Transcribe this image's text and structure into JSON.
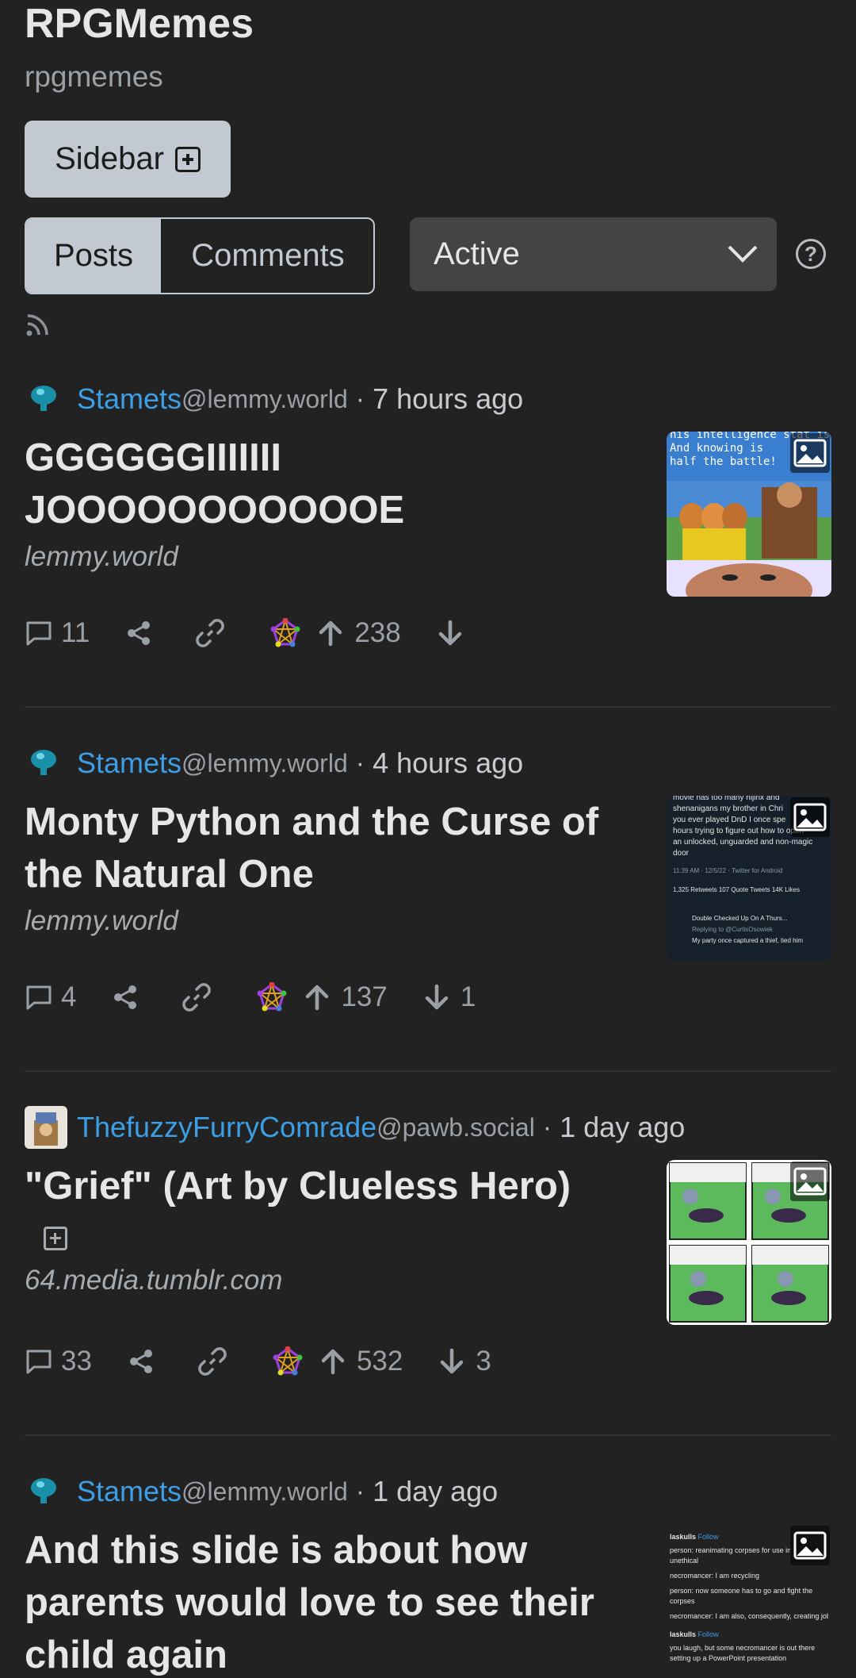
{
  "community": {
    "title": "RPGMemes",
    "name": "rpgmemes"
  },
  "buttons": {
    "sidebar_label": "Sidebar"
  },
  "view_toggle": {
    "posts_label": "Posts",
    "comments_label": "Comments"
  },
  "sort": {
    "selected": "Active"
  },
  "icons": {
    "help": "question-circle-icon",
    "rss": "rss-icon",
    "comment": "comment-icon",
    "share": "share-icon",
    "link": "link-icon",
    "fediverse": "fediverse-icon",
    "upvote": "arrow-up-icon",
    "downvote": "arrow-down-icon",
    "image": "image-icon",
    "expand": "plus-square-icon"
  },
  "colors": {
    "background": "#222222",
    "accent": "#3c9ee5",
    "button": "#c2c9d0",
    "select": "#444444"
  },
  "posts": [
    {
      "user": "Stamets",
      "instance": "@lemmy.world",
      "time": "7 hours ago",
      "title_line1": "GGGGGGIIIIIII",
      "title_line2": "JOOOOOOOOOOOE",
      "domain": "lemmy.world",
      "comments": "11",
      "upvotes": "238",
      "downvotes": ""
    },
    {
      "user": "Stamets",
      "instance": "@lemmy.world",
      "time": "4 hours ago",
      "title_line1": "Monty Python and the Curse of",
      "title_line2": "the Natural One",
      "domain": "lemmy.world",
      "comments": "4",
      "upvotes": "137",
      "downvotes": "1"
    },
    {
      "user": "ThefuzzyFurryComrade",
      "instance": "@pawb.social",
      "time": "1 day ago",
      "title_line1": "\"Grief\" (Art by Clueless Hero)",
      "title_line2": "",
      "domain": "64.media.tumblr.com",
      "comments": "33",
      "upvotes": "532",
      "downvotes": "3"
    },
    {
      "user": "Stamets",
      "instance": "@lemmy.world",
      "time": "1 day ago",
      "title_line1": "And this slide is about how",
      "title_line2": "parents would love to see their",
      "title_line3": "child again"
    }
  ],
  "thumb_text": {
    "p1": [
      "his intelligence stat is s",
      "And knowing is",
      "half the battle!"
    ],
    "p2": [
      "movie has too many hijinx and",
      "shenanigans my brother in Chri",
      "you ever played DnD I once spe",
      "hours trying to figure out how to open",
      "an unlocked, unguarded and non-magic",
      "door",
      "11:39 AM · 12/5/22 · Twitter for Android",
      "1,325 Retweets  107 Quote Tweets  14K Likes",
      "Double Checked Up On A Thurs...",
      "Replying to @CurtisOsowiek",
      "My party once captured a thief, tied him"
    ],
    "p4": [
      "laskulls",
      "Follow",
      "person: reanimating corpses for use in b",
      "unethical",
      "necromancer: I am recycling",
      "person: now someone has to go and fight the",
      "corpses",
      "necromancer: I am also, consequently, creating jobs",
      "laskulls",
      "Follow",
      "you laugh, but some necromancer is out there",
      "setting up a PowerPoint presentation"
    ]
  }
}
